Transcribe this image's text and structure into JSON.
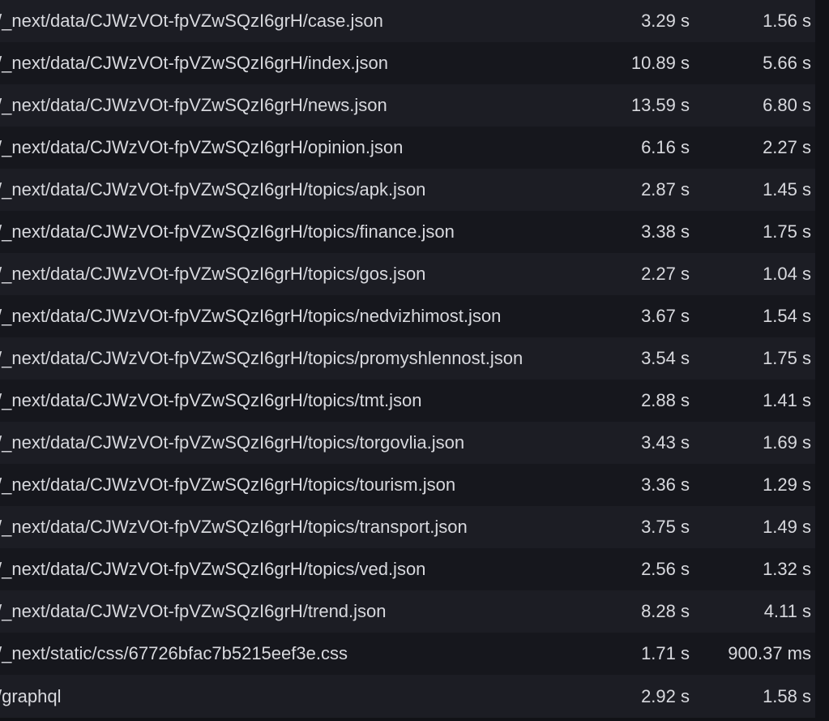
{
  "rows": [
    {
      "path": "/_next/data/CJWzVOt-fpVZwSQzI6grH/case.json",
      "t1": "3.29 s",
      "t2": "1.56 s"
    },
    {
      "path": "/_next/data/CJWzVOt-fpVZwSQzI6grH/index.json",
      "t1": "10.89 s",
      "t2": "5.66 s"
    },
    {
      "path": "/_next/data/CJWzVOt-fpVZwSQzI6grH/news.json",
      "t1": "13.59 s",
      "t2": "6.80 s"
    },
    {
      "path": "/_next/data/CJWzVOt-fpVZwSQzI6grH/opinion.json",
      "t1": "6.16 s",
      "t2": "2.27 s"
    },
    {
      "path": "/_next/data/CJWzVOt-fpVZwSQzI6grH/topics/apk.json",
      "t1": "2.87 s",
      "t2": "1.45 s"
    },
    {
      "path": "/_next/data/CJWzVOt-fpVZwSQzI6grH/topics/finance.json",
      "t1": "3.38 s",
      "t2": "1.75 s"
    },
    {
      "path": "/_next/data/CJWzVOt-fpVZwSQzI6grH/topics/gos.json",
      "t1": "2.27 s",
      "t2": "1.04 s"
    },
    {
      "path": "/_next/data/CJWzVOt-fpVZwSQzI6grH/topics/nedvizhimost.json",
      "t1": "3.67 s",
      "t2": "1.54 s"
    },
    {
      "path": "/_next/data/CJWzVOt-fpVZwSQzI6grH/topics/promyshlennost.json",
      "t1": "3.54 s",
      "t2": "1.75 s"
    },
    {
      "path": "/_next/data/CJWzVOt-fpVZwSQzI6grH/topics/tmt.json",
      "t1": "2.88 s",
      "t2": "1.41 s"
    },
    {
      "path": "/_next/data/CJWzVOt-fpVZwSQzI6grH/topics/torgovlia.json",
      "t1": "3.43 s",
      "t2": "1.69 s"
    },
    {
      "path": "/_next/data/CJWzVOt-fpVZwSQzI6grH/topics/tourism.json",
      "t1": "3.36 s",
      "t2": "1.29 s"
    },
    {
      "path": "/_next/data/CJWzVOt-fpVZwSQzI6grH/topics/transport.json",
      "t1": "3.75 s",
      "t2": "1.49 s"
    },
    {
      "path": "/_next/data/CJWzVOt-fpVZwSQzI6grH/topics/ved.json",
      "t1": "2.56 s",
      "t2": "1.32 s"
    },
    {
      "path": "/_next/data/CJWzVOt-fpVZwSQzI6grH/trend.json",
      "t1": "8.28 s",
      "t2": "4.11 s"
    },
    {
      "path": "/_next/static/css/67726bfac7b5215eef3e.css",
      "t1": "1.71 s",
      "t2": "900.37 ms"
    },
    {
      "path": "/graphql",
      "t1": "2.92 s",
      "t2": "1.58 s"
    }
  ],
  "colors": {
    "background": "#111217",
    "row_even": "#1c1d24",
    "row_odd": "#16171d",
    "text": "#d8d9de"
  }
}
